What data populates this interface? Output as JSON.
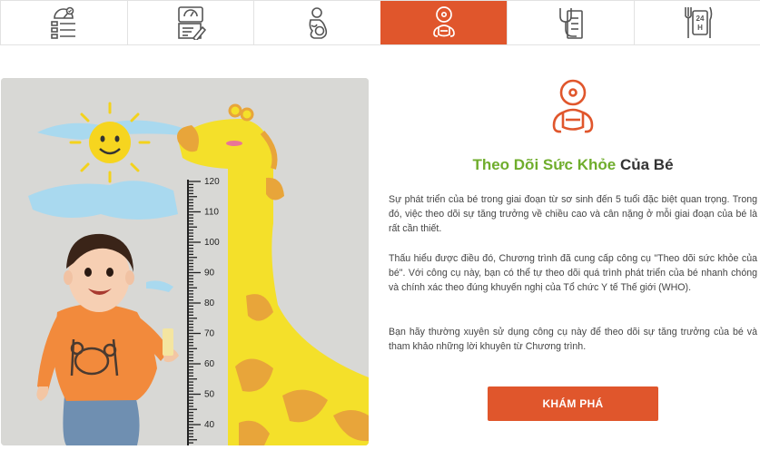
{
  "tabs": [
    {
      "icon": "dashboard-checklist-icon",
      "active": false
    },
    {
      "icon": "scale-notepad-icon",
      "active": false
    },
    {
      "icon": "pregnancy-icon",
      "active": false
    },
    {
      "icon": "baby-icon",
      "active": true
    },
    {
      "icon": "stethoscope-clipboard-icon",
      "active": false
    },
    {
      "icon": "24h-dining-icon",
      "active": false
    }
  ],
  "hero": {
    "ruler_ticks": [
      "120",
      "110",
      "100",
      "90",
      "80",
      "70",
      "60",
      "50",
      "40"
    ]
  },
  "feature": {
    "icon": "baby-icon",
    "title_highlight": "Theo Dõi Sức Khỏe",
    "title_rest": "Của Bé",
    "paragraphs": [
      "Sự phát triển của bé trong giai đoạn từ sơ sinh đến 5 tuổi đặc biệt quan trọng. Trong đó, việc theo dõi sự tăng trưởng về chiều cao và cân nặng ở mỗi giai đoạn của bé là rất cần thiết.",
      "Thấu hiểu được điều đó, Chương trình đã cung cấp công cụ \"Theo dõi sức khỏe của bé\". Với công cụ này, bạn có thể tự theo dõi quá trình phát triển của bé nhanh chóng và chính xác theo đúng khuyến nghị của Tổ chức Y tế Thế giới (WHO).",
      "Bạn hãy thường xuyên sử dụng công cụ này để theo dõi sự tăng trưởng của bé và tham khảo những lời khuyên từ Chương trình."
    ],
    "button_label": "KHÁM PHÁ"
  },
  "colors": {
    "accent": "#e0562c",
    "green": "#6fad2c",
    "icon_gray": "#555555"
  }
}
